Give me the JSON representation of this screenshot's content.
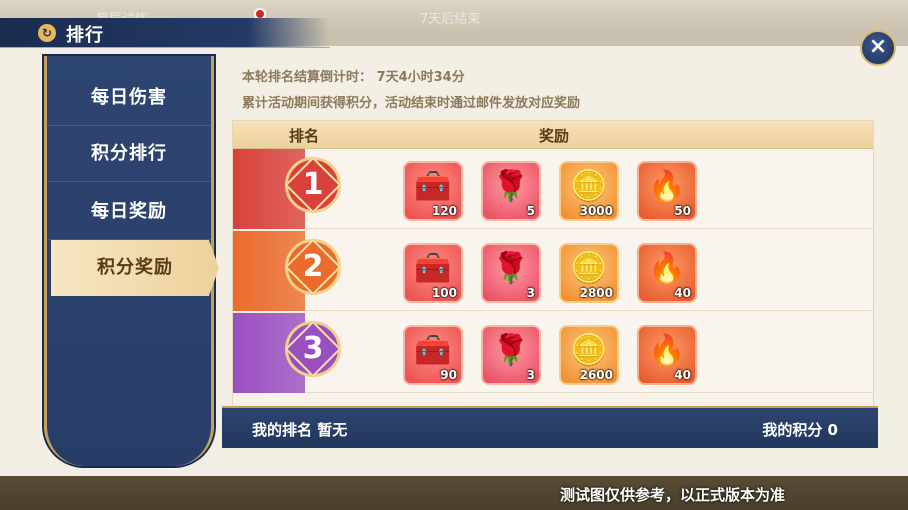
{
  "background": {
    "ghost_left": "星辰试炼",
    "ghost_center": "7天后结束"
  },
  "header": {
    "title": "排行",
    "title_icon": "return-icon",
    "close_icon": "×"
  },
  "sidebar": {
    "items": [
      {
        "label": "每日伤害"
      },
      {
        "label": "积分排行"
      },
      {
        "label": "每日奖励"
      },
      {
        "label": "积分奖励"
      }
    ],
    "active_index": 3
  },
  "info": {
    "countdown": "本轮排名结算倒计时： 7天4小时34分",
    "note": "累计活动期间获得积分，活动结束时通过邮件发放对应奖励"
  },
  "table": {
    "col_rank": "排名",
    "col_reward": "奖励",
    "rows": [
      {
        "rank": "1",
        "rank_color": "#d9413b",
        "items": [
          {
            "type": "chest",
            "glyph": "🧰",
            "qty": "120"
          },
          {
            "type": "flower",
            "glyph": "🌹",
            "qty": "5"
          },
          {
            "type": "ingot",
            "glyph": "🪙",
            "qty": "3000"
          },
          {
            "type": "coin",
            "glyph": "🔥",
            "qty": "50"
          }
        ]
      },
      {
        "rank": "2",
        "rank_color": "#ea6c2d",
        "items": [
          {
            "type": "chest",
            "glyph": "🧰",
            "qty": "100"
          },
          {
            "type": "flower",
            "glyph": "🌹",
            "qty": "3"
          },
          {
            "type": "ingot",
            "glyph": "🪙",
            "qty": "2800"
          },
          {
            "type": "coin",
            "glyph": "🔥",
            "qty": "40"
          }
        ]
      },
      {
        "rank": "3",
        "rank_color": "#9a4fc0",
        "items": [
          {
            "type": "chest",
            "glyph": "🧰",
            "qty": "90"
          },
          {
            "type": "flower",
            "glyph": "🌹",
            "qty": "3"
          },
          {
            "type": "ingot",
            "glyph": "🪙",
            "qty": "2600"
          },
          {
            "type": "coin",
            "glyph": "🔥",
            "qty": "40"
          }
        ]
      }
    ]
  },
  "footer": {
    "my_rank": "我的排名 暂无",
    "my_score": "我的积分 0"
  },
  "watermark": "测试图仅供参考，以正式版本为准"
}
